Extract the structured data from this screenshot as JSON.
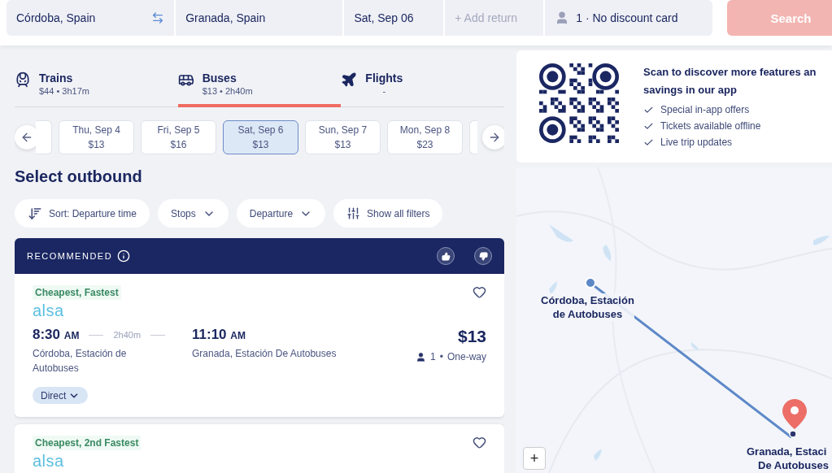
{
  "search_bar": {
    "origin": "Córdoba, Spain",
    "destination": "Granada, Spain",
    "date": "Sat, Sep 06",
    "return_placeholder": "+ Add return",
    "passengers": "1 · No discount card",
    "search_button": "Search"
  },
  "modes": [
    {
      "kind": "train",
      "label": "Trains",
      "summary": "$44 • 3h17m",
      "selected": false
    },
    {
      "kind": "bus",
      "label": "Buses",
      "summary": "$13 • 2h40m",
      "selected": true
    },
    {
      "kind": "flight",
      "label": "Flights",
      "summary": "-",
      "selected": false
    }
  ],
  "dates": [
    {
      "day": "Thu, Sep 4",
      "price": "$13",
      "selected": false
    },
    {
      "day": "Fri, Sep 5",
      "price": "$16",
      "selected": false
    },
    {
      "day": "Sat, Sep 6",
      "price": "$13",
      "selected": true
    },
    {
      "day": "Sun, Sep 7",
      "price": "$13",
      "selected": false
    },
    {
      "day": "Mon, Sep 8",
      "price": "$23",
      "selected": false
    }
  ],
  "heading": "Select outbound",
  "filters": [
    {
      "kind": "sort",
      "label": "Sort: Departure time"
    },
    {
      "kind": "dropdown",
      "label": "Stops"
    },
    {
      "kind": "dropdown",
      "label": "Departure"
    },
    {
      "kind": "all",
      "label": "Show all filters"
    }
  ],
  "recommended_label": "RECOMMENDED",
  "results": [
    {
      "tag": "Cheapest, Fastest",
      "operator": "alsa",
      "depart_time": "8:30",
      "depart_period": "AM",
      "duration": "2h40m",
      "arrive_time": "11:10",
      "arrive_period": "AM",
      "from": "Córdoba, Estación de Autobuses",
      "to": "Granada, Estación De Autobuses",
      "price": "$13",
      "passengers": "1",
      "separator": "•",
      "fare": "One-way",
      "stops": "Direct"
    },
    {
      "tag": "Cheapest, 2nd Fastest",
      "operator": "alsa"
    }
  ],
  "app_promo": {
    "title_lines": [
      "Scan to discover more features an",
      "savings in our app"
    ],
    "benefits": [
      "Special in-app offers",
      "Tickets available offline",
      "Live trip updates"
    ]
  },
  "map": {
    "kind": "picture",
    "origin_label": [
      "Córdoba, Estación",
      "de Autobuses"
    ],
    "destination_label": [
      "Granada, Estaci",
      "De Autobuses"
    ],
    "zoom_in": "+"
  }
}
